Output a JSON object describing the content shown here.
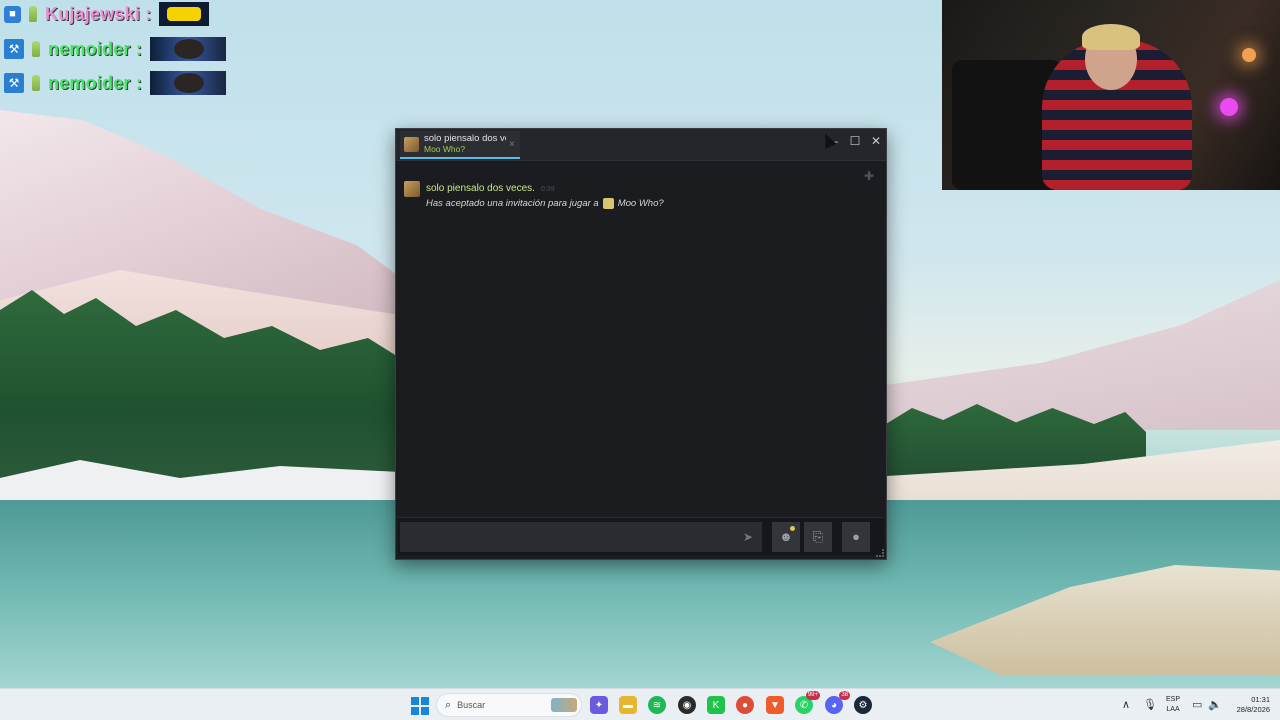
{
  "overlay": {
    "messages": [
      {
        "user": "Kujajewski :",
        "color": "#e98fd2",
        "badge": "cube-icon",
        "emote": "taxi-emote"
      },
      {
        "user": "nemoider :",
        "color": "#49e36a",
        "badge": "tool-icon",
        "emote": "face-emote"
      },
      {
        "user": "nemoider :",
        "color": "#49e36a",
        "badge": "tool-icon",
        "emote": "face-emote"
      }
    ]
  },
  "chat_window": {
    "tab": {
      "name": "solo piensalo dos veces.",
      "game": "Moo Who?",
      "close": "×"
    },
    "controls": {
      "minimize": "—",
      "maximize": "☐",
      "close": "✕"
    },
    "message": {
      "author": "solo piensalo dos veces.",
      "time": "0:39",
      "text": "Has aceptado una invitación para jugar a",
      "game": "Moo Who?"
    },
    "composer": {
      "value": "",
      "send": "➤",
      "emoji": "☻",
      "attach": "⎘",
      "voice": "●"
    }
  },
  "taskbar": {
    "search_placeholder": "Buscar",
    "apps": [
      {
        "name": "copilot-icon",
        "color": "#6a5ae0"
      },
      {
        "name": "file-explorer-icon",
        "color": "#e8b531"
      },
      {
        "name": "spotify-icon",
        "color": "#1db954"
      },
      {
        "name": "obs-icon",
        "color": "#2b2b2b"
      },
      {
        "name": "app-green-icon",
        "color": "#1fc24a"
      },
      {
        "name": "chrome-icon",
        "color": "#dd4b39"
      },
      {
        "name": "brave-icon",
        "color": "#f05c29"
      },
      {
        "name": "whatsapp-icon",
        "color": "#25d366",
        "badge": "99+"
      },
      {
        "name": "discord-icon",
        "color": "#5865f2",
        "badge": "38"
      },
      {
        "name": "steam-icon",
        "color": "#1b2838"
      }
    ],
    "lang_top": "ESP",
    "lang_bottom": "LAA",
    "time": "01:31",
    "date": "28/8/2026"
  }
}
